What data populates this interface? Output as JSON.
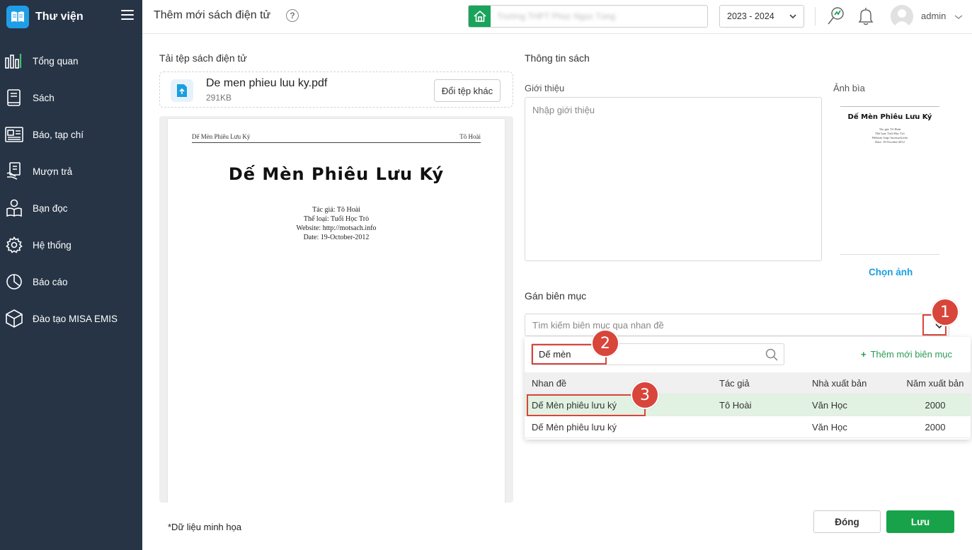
{
  "app": {
    "title": "Thư viện"
  },
  "sidebar": {
    "items": [
      {
        "label": "Tổng quan",
        "icon": "bar-chart-icon"
      },
      {
        "label": "Sách",
        "icon": "book-icon"
      },
      {
        "label": "Báo, tạp chí",
        "icon": "newspaper-icon"
      },
      {
        "label": "Mượn trả",
        "icon": "borrow-icon"
      },
      {
        "label": "Bạn đọc",
        "icon": "reader-icon"
      },
      {
        "label": "Hệ thống",
        "icon": "gear-icon"
      },
      {
        "label": "Báo cáo",
        "icon": "pie-chart-icon"
      },
      {
        "label": "Đào tạo MISA EMIS",
        "icon": "cube-icon"
      }
    ]
  },
  "header": {
    "title": "Thêm mới sách điện tử",
    "help": "?",
    "school_name": "Trường THPT Phúc Ngọc Tùng",
    "year": "2023 - 2024",
    "user": "admin"
  },
  "upload": {
    "section": "Tải tệp sách điện tử",
    "file_name": "De men phieu luu ky.pdf",
    "file_size": "291KB",
    "change_label": "Đổi tệp khác"
  },
  "preview": {
    "header_left": "Dế Mèn Phiêu Lưu Ký",
    "header_right": "Tô Hoài",
    "title": "Dế Mèn Phiêu Lưu Ký",
    "meta": [
      "Tác giả: Tô Hoài",
      "Thể loại: Tuổi Học Trò",
      "Website: http://motsach.info",
      "Date: 19-October-2012"
    ]
  },
  "book_info": {
    "section": "Thông tin sách",
    "intro_label": "Giới thiệu",
    "intro_placeholder": "Nhập giới thiệu",
    "cover_label": "Ảnh bìa",
    "choose_image": "Chọn ảnh"
  },
  "catalog": {
    "section": "Gán biên mục",
    "placeholder": "Tìm kiếm biên mục qua nhan đề",
    "search_value": "Dế mèn",
    "add_new": "Thêm mới biên mục",
    "columns": {
      "title": "Nhan đề",
      "author": "Tác giả",
      "publisher": "Nhà xuất bản",
      "year": "Năm xuất bản"
    },
    "rows": [
      {
        "title": "Dế Mèn phiêu lưu ký",
        "author": "Tô Hoài",
        "publisher": "Văn Học",
        "year": "2000"
      },
      {
        "title": "Dế Mèn phiêu lưu ký",
        "author": "",
        "publisher": "Văn Học",
        "year": "2000"
      }
    ]
  },
  "annotations": {
    "step1": "1",
    "step2": "2",
    "step3": "3"
  },
  "footer": {
    "note": "*Dữ liệu minh họa",
    "close_label": "Đóng",
    "save_label": "Lưu"
  },
  "colors": {
    "sidebar": "#263446",
    "accent_green": "#18a34a",
    "link_blue": "#1a9fe0",
    "annotation_red": "#d8453b"
  }
}
